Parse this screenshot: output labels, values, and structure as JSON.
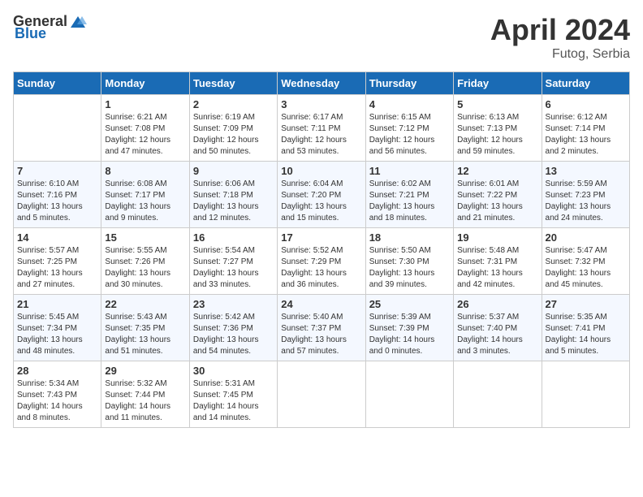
{
  "header": {
    "logo_general": "General",
    "logo_blue": "Blue",
    "title": "April 2024",
    "location": "Futog, Serbia"
  },
  "calendar": {
    "days_of_week": [
      "Sunday",
      "Monday",
      "Tuesday",
      "Wednesday",
      "Thursday",
      "Friday",
      "Saturday"
    ],
    "weeks": [
      {
        "cells": [
          {
            "day": "",
            "empty": true
          },
          {
            "day": "1",
            "sunrise": "6:21 AM",
            "sunset": "7:08 PM",
            "daylight": "12 hours and 47 minutes."
          },
          {
            "day": "2",
            "sunrise": "6:19 AM",
            "sunset": "7:09 PM",
            "daylight": "12 hours and 50 minutes."
          },
          {
            "day": "3",
            "sunrise": "6:17 AM",
            "sunset": "7:11 PM",
            "daylight": "12 hours and 53 minutes."
          },
          {
            "day": "4",
            "sunrise": "6:15 AM",
            "sunset": "7:12 PM",
            "daylight": "12 hours and 56 minutes."
          },
          {
            "day": "5",
            "sunrise": "6:13 AM",
            "sunset": "7:13 PM",
            "daylight": "12 hours and 59 minutes."
          },
          {
            "day": "6",
            "sunrise": "6:12 AM",
            "sunset": "7:14 PM",
            "daylight": "13 hours and 2 minutes."
          }
        ]
      },
      {
        "cells": [
          {
            "day": "7",
            "sunrise": "6:10 AM",
            "sunset": "7:16 PM",
            "daylight": "13 hours and 5 minutes."
          },
          {
            "day": "8",
            "sunrise": "6:08 AM",
            "sunset": "7:17 PM",
            "daylight": "13 hours and 9 minutes."
          },
          {
            "day": "9",
            "sunrise": "6:06 AM",
            "sunset": "7:18 PM",
            "daylight": "13 hours and 12 minutes."
          },
          {
            "day": "10",
            "sunrise": "6:04 AM",
            "sunset": "7:20 PM",
            "daylight": "13 hours and 15 minutes."
          },
          {
            "day": "11",
            "sunrise": "6:02 AM",
            "sunset": "7:21 PM",
            "daylight": "13 hours and 18 minutes."
          },
          {
            "day": "12",
            "sunrise": "6:01 AM",
            "sunset": "7:22 PM",
            "daylight": "13 hours and 21 minutes."
          },
          {
            "day": "13",
            "sunrise": "5:59 AM",
            "sunset": "7:23 PM",
            "daylight": "13 hours and 24 minutes."
          }
        ]
      },
      {
        "cells": [
          {
            "day": "14",
            "sunrise": "5:57 AM",
            "sunset": "7:25 PM",
            "daylight": "13 hours and 27 minutes."
          },
          {
            "day": "15",
            "sunrise": "5:55 AM",
            "sunset": "7:26 PM",
            "daylight": "13 hours and 30 minutes."
          },
          {
            "day": "16",
            "sunrise": "5:54 AM",
            "sunset": "7:27 PM",
            "daylight": "13 hours and 33 minutes."
          },
          {
            "day": "17",
            "sunrise": "5:52 AM",
            "sunset": "7:29 PM",
            "daylight": "13 hours and 36 minutes."
          },
          {
            "day": "18",
            "sunrise": "5:50 AM",
            "sunset": "7:30 PM",
            "daylight": "13 hours and 39 minutes."
          },
          {
            "day": "19",
            "sunrise": "5:48 AM",
            "sunset": "7:31 PM",
            "daylight": "13 hours and 42 minutes."
          },
          {
            "day": "20",
            "sunrise": "5:47 AM",
            "sunset": "7:32 PM",
            "daylight": "13 hours and 45 minutes."
          }
        ]
      },
      {
        "cells": [
          {
            "day": "21",
            "sunrise": "5:45 AM",
            "sunset": "7:34 PM",
            "daylight": "13 hours and 48 minutes."
          },
          {
            "day": "22",
            "sunrise": "5:43 AM",
            "sunset": "7:35 PM",
            "daylight": "13 hours and 51 minutes."
          },
          {
            "day": "23",
            "sunrise": "5:42 AM",
            "sunset": "7:36 PM",
            "daylight": "13 hours and 54 minutes."
          },
          {
            "day": "24",
            "sunrise": "5:40 AM",
            "sunset": "7:37 PM",
            "daylight": "13 hours and 57 minutes."
          },
          {
            "day": "25",
            "sunrise": "5:39 AM",
            "sunset": "7:39 PM",
            "daylight": "14 hours and 0 minutes."
          },
          {
            "day": "26",
            "sunrise": "5:37 AM",
            "sunset": "7:40 PM",
            "daylight": "14 hours and 3 minutes."
          },
          {
            "day": "27",
            "sunrise": "5:35 AM",
            "sunset": "7:41 PM",
            "daylight": "14 hours and 5 minutes."
          }
        ]
      },
      {
        "cells": [
          {
            "day": "28",
            "sunrise": "5:34 AM",
            "sunset": "7:43 PM",
            "daylight": "14 hours and 8 minutes."
          },
          {
            "day": "29",
            "sunrise": "5:32 AM",
            "sunset": "7:44 PM",
            "daylight": "14 hours and 11 minutes."
          },
          {
            "day": "30",
            "sunrise": "5:31 AM",
            "sunset": "7:45 PM",
            "daylight": "14 hours and 14 minutes."
          },
          {
            "day": "",
            "empty": true
          },
          {
            "day": "",
            "empty": true
          },
          {
            "day": "",
            "empty": true
          },
          {
            "day": "",
            "empty": true
          }
        ]
      }
    ]
  }
}
